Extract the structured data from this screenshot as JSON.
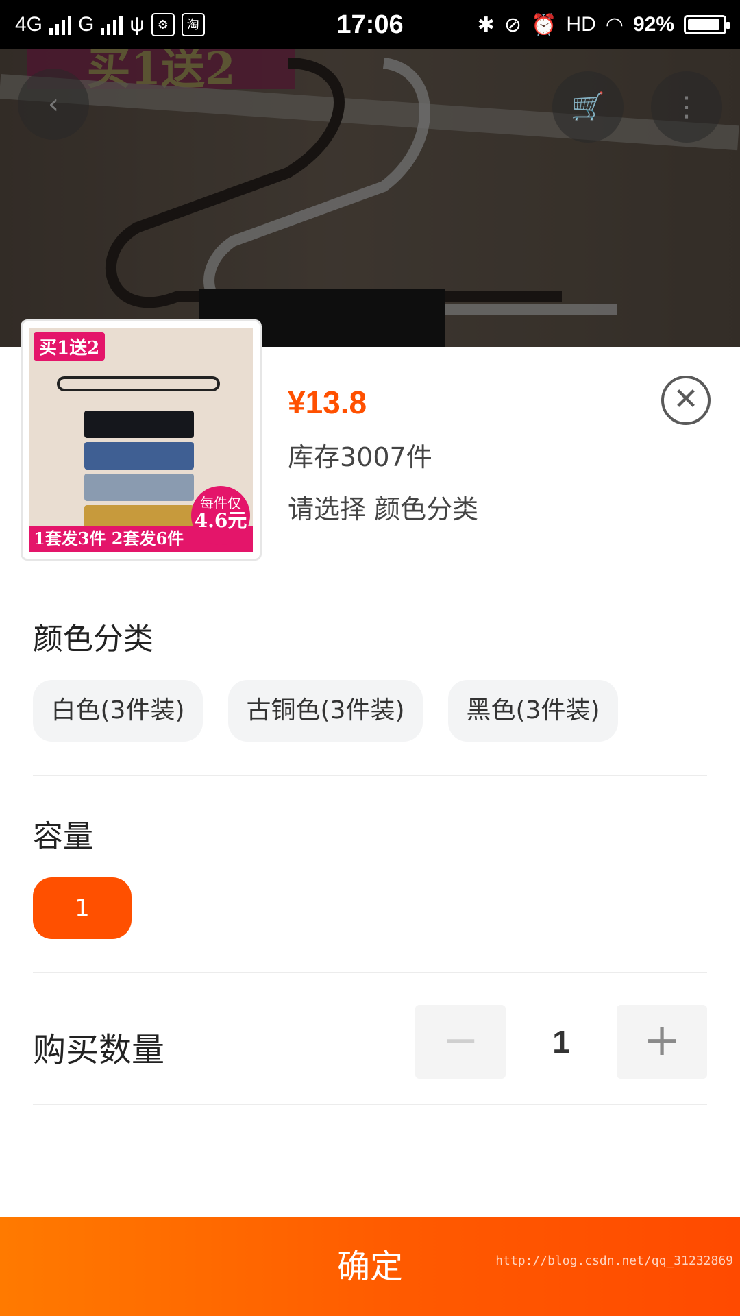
{
  "status_bar": {
    "network1": "4G",
    "network2": "G",
    "app_icon": "淘",
    "time": "17:06",
    "hd": "HD",
    "battery_percent": "92%",
    "battery_level": 0.92
  },
  "background": {
    "badge_text": "买1送2"
  },
  "product": {
    "thumb_promo_top": "买1送2",
    "thumb_promo_bottom": "1套发3件 2套发6件",
    "thumb_badge_line1": "每件仅",
    "thumb_badge_line2": "4.6元",
    "price": "¥13.8",
    "stock": "库存3007件",
    "choose_hint": "请选择 颜色分类"
  },
  "color_section": {
    "title": "颜色分类",
    "options": [
      "白色(3件装)",
      "古铜色(3件装)",
      "黑色(3件装)"
    ]
  },
  "capacity_section": {
    "title": "容量",
    "options": [
      "1"
    ]
  },
  "quantity_section": {
    "title": "购买数量",
    "value": "1",
    "minus": "−",
    "plus": "+"
  },
  "confirm_label": "确定",
  "watermark": "http://blog.csdn.net/qq_31232869",
  "colors": {
    "accent": "#ff5000",
    "chip_bg": "#f3f4f5"
  }
}
